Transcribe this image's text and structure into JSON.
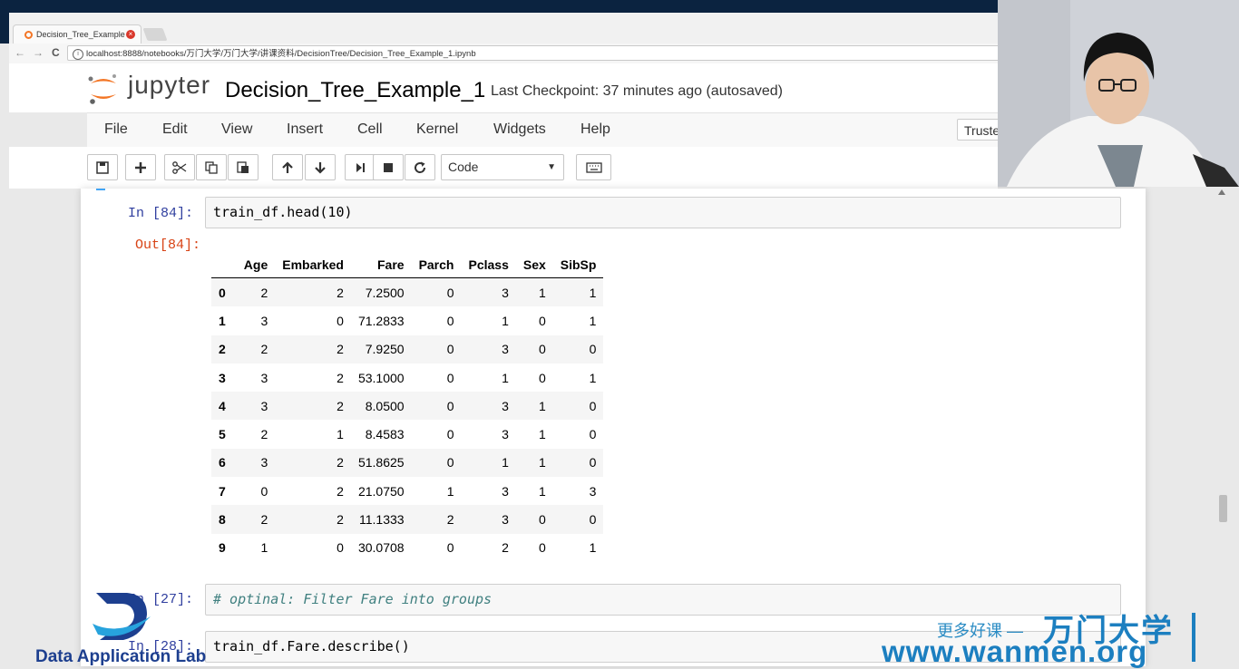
{
  "browser": {
    "tab_title": "Decision_Tree_Example",
    "tab_close": "×",
    "url": "localhost:8888/notebooks/万门大学/万门大学/讲课资料/DecisionTree/Decision_Tree_Example_1.ipynb",
    "back": "←",
    "forward": "→",
    "reload": "C",
    "info": "i"
  },
  "header": {
    "logo_text": "jupyter",
    "notebook_title": "Decision_Tree_Example_1",
    "checkpoint": "Last Checkpoint: 37 minutes ago (autosaved)"
  },
  "menu": {
    "items": [
      "File",
      "Edit",
      "View",
      "Insert",
      "Cell",
      "Kernel",
      "Widgets",
      "Help"
    ],
    "trusted": "Truste"
  },
  "toolbar": {
    "cell_type": "Code",
    "dropdown_arrow": "▼"
  },
  "cells": {
    "c1": {
      "prompt": "In  [84]:",
      "code": "train_df.head(10)",
      "out_prompt": "Out[84]:"
    },
    "c2": {
      "prompt": "In  [27]:",
      "code": "# optinal: Filter Fare into groups"
    },
    "c3": {
      "prompt": "In  [28]:",
      "code": "train_df.Fare.describe()"
    }
  },
  "dataframe": {
    "columns": [
      "",
      "Age",
      "Embarked",
      "Fare",
      "Parch",
      "Pclass",
      "Sex",
      "SibSp"
    ],
    "rows": [
      [
        "0",
        "2",
        "2",
        "7.2500",
        "0",
        "3",
        "1",
        "1"
      ],
      [
        "1",
        "3",
        "0",
        "71.2833",
        "0",
        "1",
        "0",
        "1"
      ],
      [
        "2",
        "2",
        "2",
        "7.9250",
        "0",
        "3",
        "0",
        "0"
      ],
      [
        "3",
        "3",
        "2",
        "53.1000",
        "0",
        "1",
        "0",
        "1"
      ],
      [
        "4",
        "3",
        "2",
        "8.0500",
        "0",
        "3",
        "1",
        "0"
      ],
      [
        "5",
        "2",
        "1",
        "8.4583",
        "0",
        "3",
        "1",
        "0"
      ],
      [
        "6",
        "3",
        "2",
        "51.8625",
        "0",
        "1",
        "1",
        "0"
      ],
      [
        "7",
        "0",
        "2",
        "21.0750",
        "1",
        "3",
        "1",
        "3"
      ],
      [
        "8",
        "2",
        "2",
        "11.1333",
        "2",
        "3",
        "0",
        "0"
      ],
      [
        "9",
        "1",
        "0",
        "30.0708",
        "0",
        "2",
        "0",
        "1"
      ]
    ]
  },
  "watermark": {
    "dal_text": "Data Application Lab",
    "sub": "更多好课 —",
    "brand": "万门大学",
    "url": "www.wanmen.org"
  },
  "colors": {
    "jupyter_orange": "#f37626",
    "in_prompt": "#303f9f",
    "out_prompt": "#d84315",
    "watermark_blue": "#1c7fc0"
  }
}
